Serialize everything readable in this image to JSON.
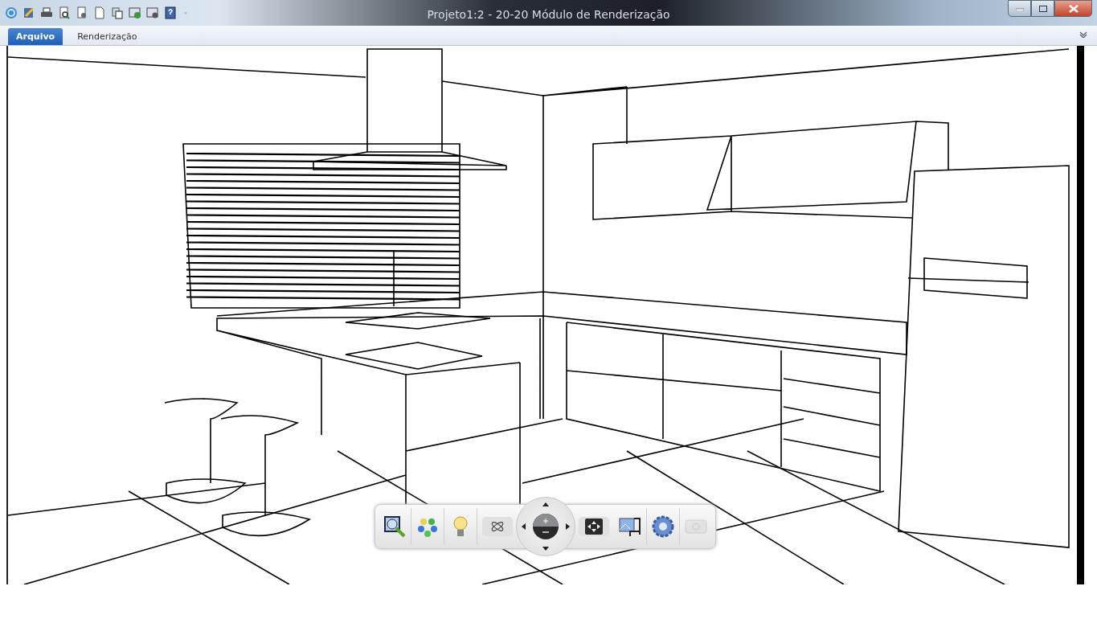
{
  "window": {
    "title": "Projeto1:2 - 20-20 Módulo de Renderização"
  },
  "tabs": [
    {
      "label": "Arquivo",
      "selected": true
    },
    {
      "label": "Renderização",
      "selected": false
    }
  ]
}
